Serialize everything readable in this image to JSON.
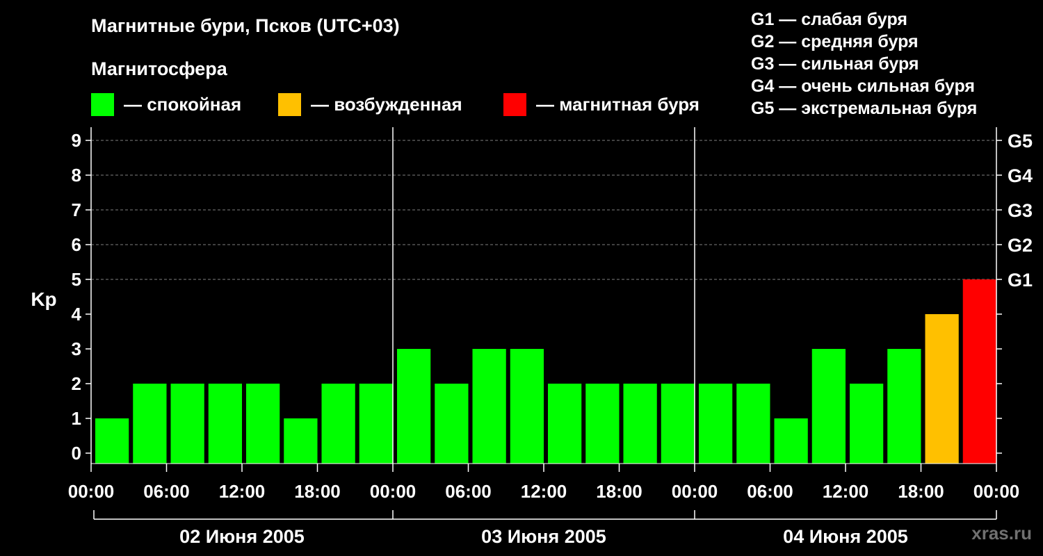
{
  "title": "Магнитные бури, Псков (UTC+03)",
  "subtitle": "Магнитосфера",
  "legend": [
    {
      "label": "— спокойная",
      "color": "#00FF00"
    },
    {
      "label": "— возбужденная",
      "color": "#FFC000"
    },
    {
      "label": "— магнитная буря",
      "color": "#FF0000"
    }
  ],
  "g_scale": [
    "G1 — слабая буря",
    "G2 — средняя буря",
    "G3 — сильная буря",
    "G4 — очень сильная буря",
    "G5 — экстремальная буря"
  ],
  "watermark": "xras.ru",
  "chart_data": {
    "type": "bar",
    "ylabel": "Kp",
    "ylim": [
      0,
      9
    ],
    "yticks": [
      0,
      1,
      2,
      3,
      4,
      5,
      6,
      7,
      8,
      9
    ],
    "right_ticks": [
      {
        "value": 5,
        "label": "G1"
      },
      {
        "value": 6,
        "label": "G2"
      },
      {
        "value": 7,
        "label": "G3"
      },
      {
        "value": 8,
        "label": "G4"
      },
      {
        "value": 9,
        "label": "G5"
      }
    ],
    "xtick_labels": [
      "00:00",
      "06:00",
      "12:00",
      "18:00",
      "00:00",
      "06:00",
      "12:00",
      "18:00",
      "00:00",
      "06:00",
      "12:00",
      "18:00",
      "00:00"
    ],
    "days": [
      "02 Июня 2005",
      "03 Июня 2005",
      "04 Июня 2005"
    ],
    "values": [
      1,
      2,
      2,
      2,
      2,
      1,
      2,
      2,
      3,
      2,
      3,
      3,
      2,
      2,
      2,
      2,
      2,
      2,
      1,
      3,
      2,
      3,
      4,
      5
    ],
    "colors": {
      "quiet": "#00FF00",
      "active": "#FFC000",
      "storm": "#FF0000"
    },
    "grid": true
  }
}
